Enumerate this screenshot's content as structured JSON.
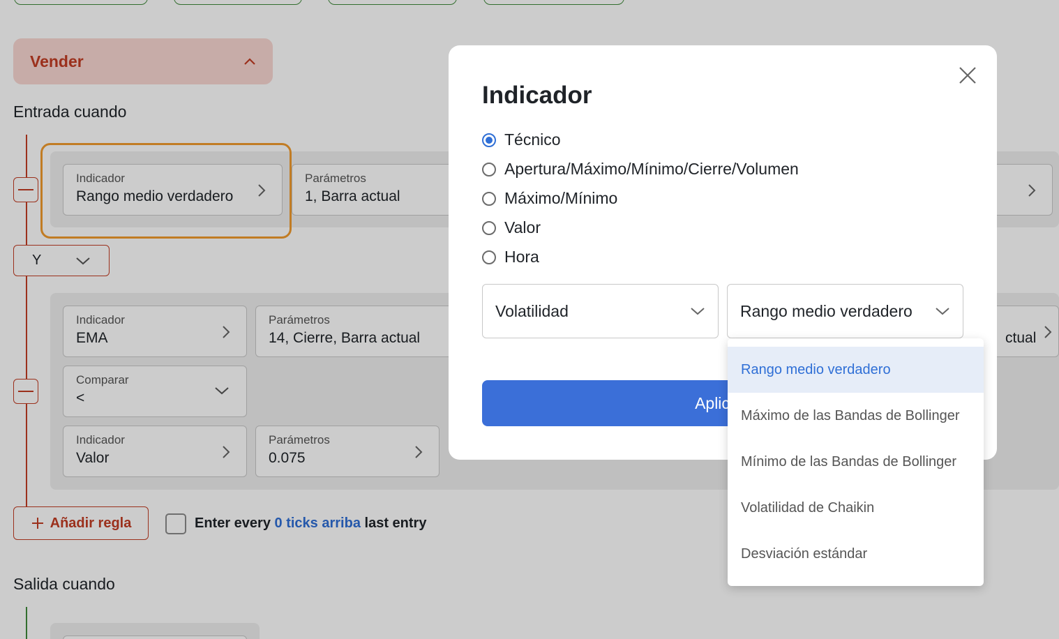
{
  "background": {
    "sell_toggle": {
      "label": "Vender"
    },
    "entry_title": "Entrada cuando",
    "exit_title": "Salida cuando",
    "rule1": {
      "indicator": {
        "label": "Indicador",
        "value": "Rango medio verdadero"
      },
      "params": {
        "label": "Parámetros",
        "value": "1, Barra actual"
      }
    },
    "logic_select": {
      "value": "Y"
    },
    "rule2": {
      "indicator": {
        "label": "Indicador",
        "value": "EMA"
      },
      "params": {
        "label": "Parámetros",
        "value": "14, Cierre, Barra actual"
      },
      "params_right_fragment": "ctual",
      "compare": {
        "label": "Comparar",
        "value": "<"
      },
      "indicator2": {
        "label": "Indicador",
        "value": "Valor"
      },
      "params2": {
        "label": "Parámetros",
        "value": "0.075"
      }
    },
    "add_rule": {
      "label": "Añadir regla"
    },
    "enter_every": {
      "prefix": "Enter every",
      "link": "0 ticks arriba",
      "suffix": "last entry"
    }
  },
  "modal": {
    "title": "Indicador",
    "radios": [
      {
        "label": "Técnico",
        "checked": true
      },
      {
        "label": "Apertura/Máximo/Mínimo/Cierre/Volumen",
        "checked": false
      },
      {
        "label": "Máximo/Mínimo",
        "checked": false
      },
      {
        "label": "Valor",
        "checked": false
      },
      {
        "label": "Hora",
        "checked": false
      }
    ],
    "category_select": {
      "value": "Volatilidad"
    },
    "indicator_select": {
      "value": "Rango medio verdadero"
    },
    "apply_button": {
      "label": "Aplic"
    }
  },
  "dropdown": {
    "options": [
      {
        "label": "Rango medio verdadero",
        "selected": true
      },
      {
        "label": "Máximo de las Bandas de Bollinger",
        "selected": false
      },
      {
        "label": "Mínimo de las Bandas de Bollinger",
        "selected": false
      },
      {
        "label": "Volatilidad de Chaikin",
        "selected": false
      },
      {
        "label": "Desviación estándar",
        "selected": false
      }
    ]
  },
  "colors": {
    "accent_blue": "#2f6fd6",
    "sell_red": "#c23c23",
    "highlight_orange": "#f29c2e",
    "buy_green": "#3f8a3a"
  }
}
